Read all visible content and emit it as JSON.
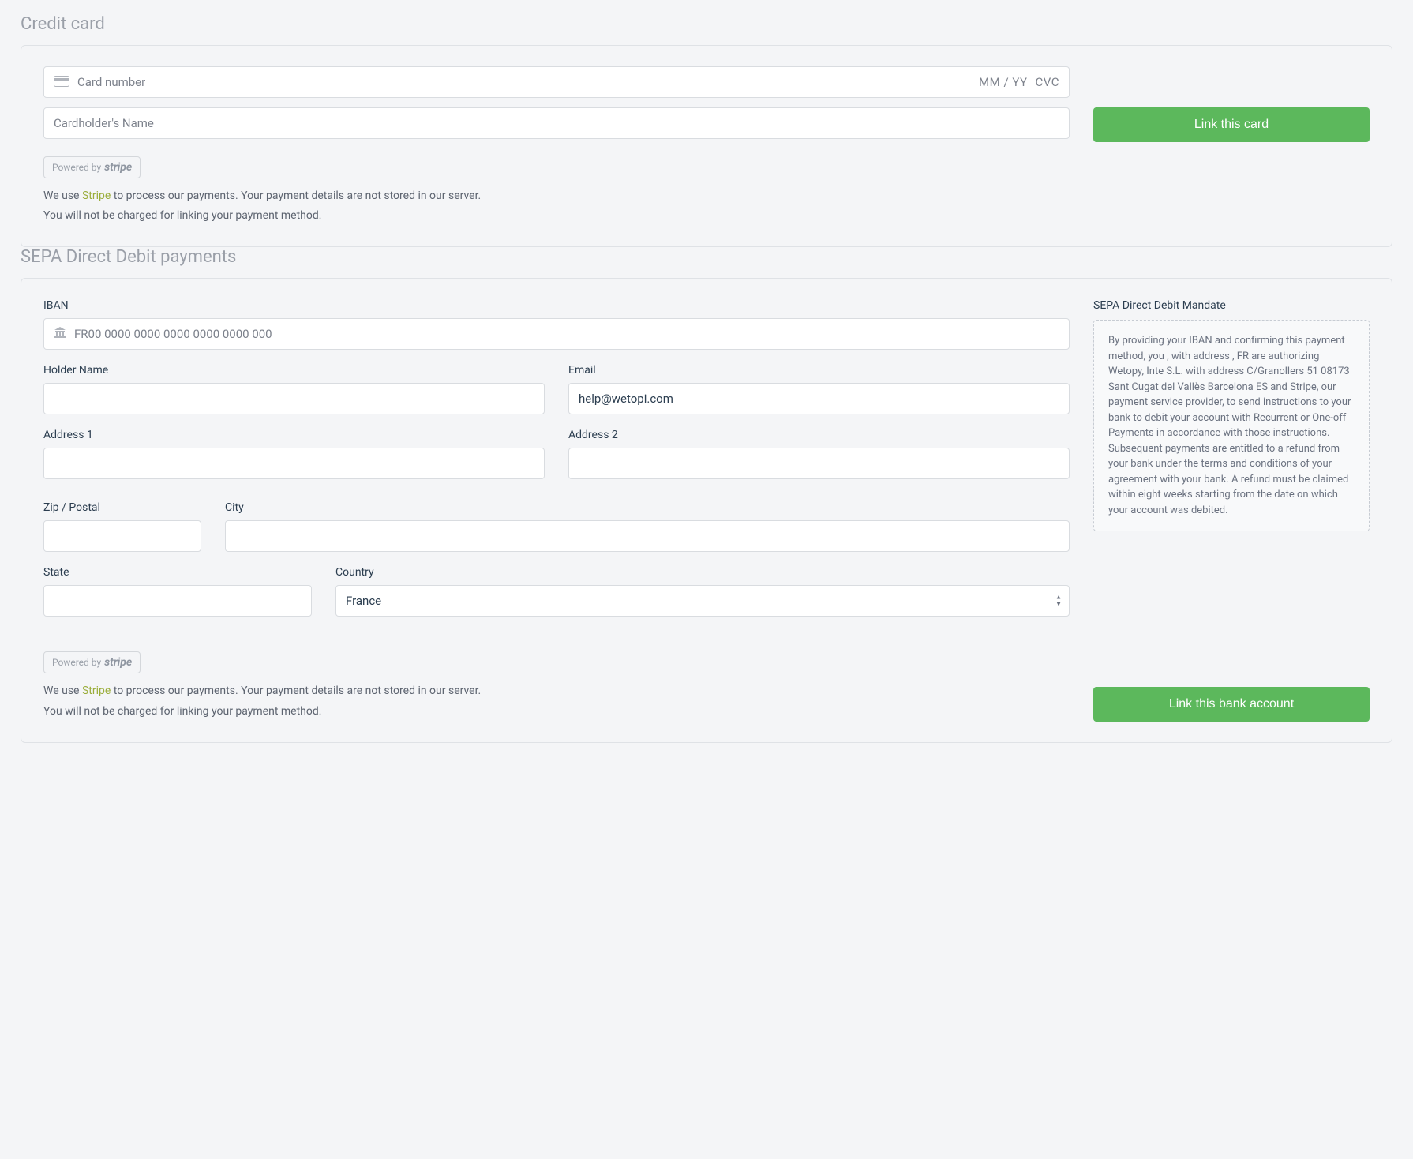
{
  "credit_card": {
    "title": "Credit card",
    "card_number_placeholder": "Card number",
    "expiry_placeholder": "MM / YY",
    "cvc_placeholder": "CVC",
    "cardholder_placeholder": "Cardholder's Name",
    "link_button": "Link this card"
  },
  "stripe_badge": {
    "prefix": "Powered by",
    "brand": "stripe"
  },
  "info": {
    "line1_pre": "We use ",
    "line1_link": "Stripe",
    "line1_post": " to process our payments. Your payment details are not stored in our server.",
    "line2": "You will not be charged for linking your payment method."
  },
  "sepa": {
    "title": "SEPA Direct Debit payments",
    "iban_label": "IBAN",
    "iban_placeholder": "FR00 0000 0000 0000 0000 0000 000",
    "holder_name_label": "Holder Name",
    "holder_name_value": "",
    "email_label": "Email",
    "email_value": "help@wetopi.com",
    "address1_label": "Address 1",
    "address1_value": "",
    "address2_label": "Address 2",
    "address2_value": "",
    "zip_label": "Zip / Postal",
    "zip_value": "",
    "city_label": "City",
    "city_value": "",
    "state_label": "State",
    "state_value": "",
    "country_label": "Country",
    "country_value": "France",
    "link_button": "Link this bank account",
    "mandate_title": "SEPA Direct Debit Mandate",
    "mandate_text": "By providing your IBAN and confirming this payment method, you , with address , FR are authorizing Wetopy, Inte S.L. with address C/Granollers 51 08173 Sant Cugat del Vallès Barcelona ES and Stripe, our payment service provider, to send instructions to your bank to debit your account with Recurrent or One-off Payments in accordance with those instructions. Subsequent payments are entitled to a refund from your bank under the terms and conditions of your agreement with your bank. A refund must be claimed within eight weeks starting from the date on which your account was debited."
  }
}
